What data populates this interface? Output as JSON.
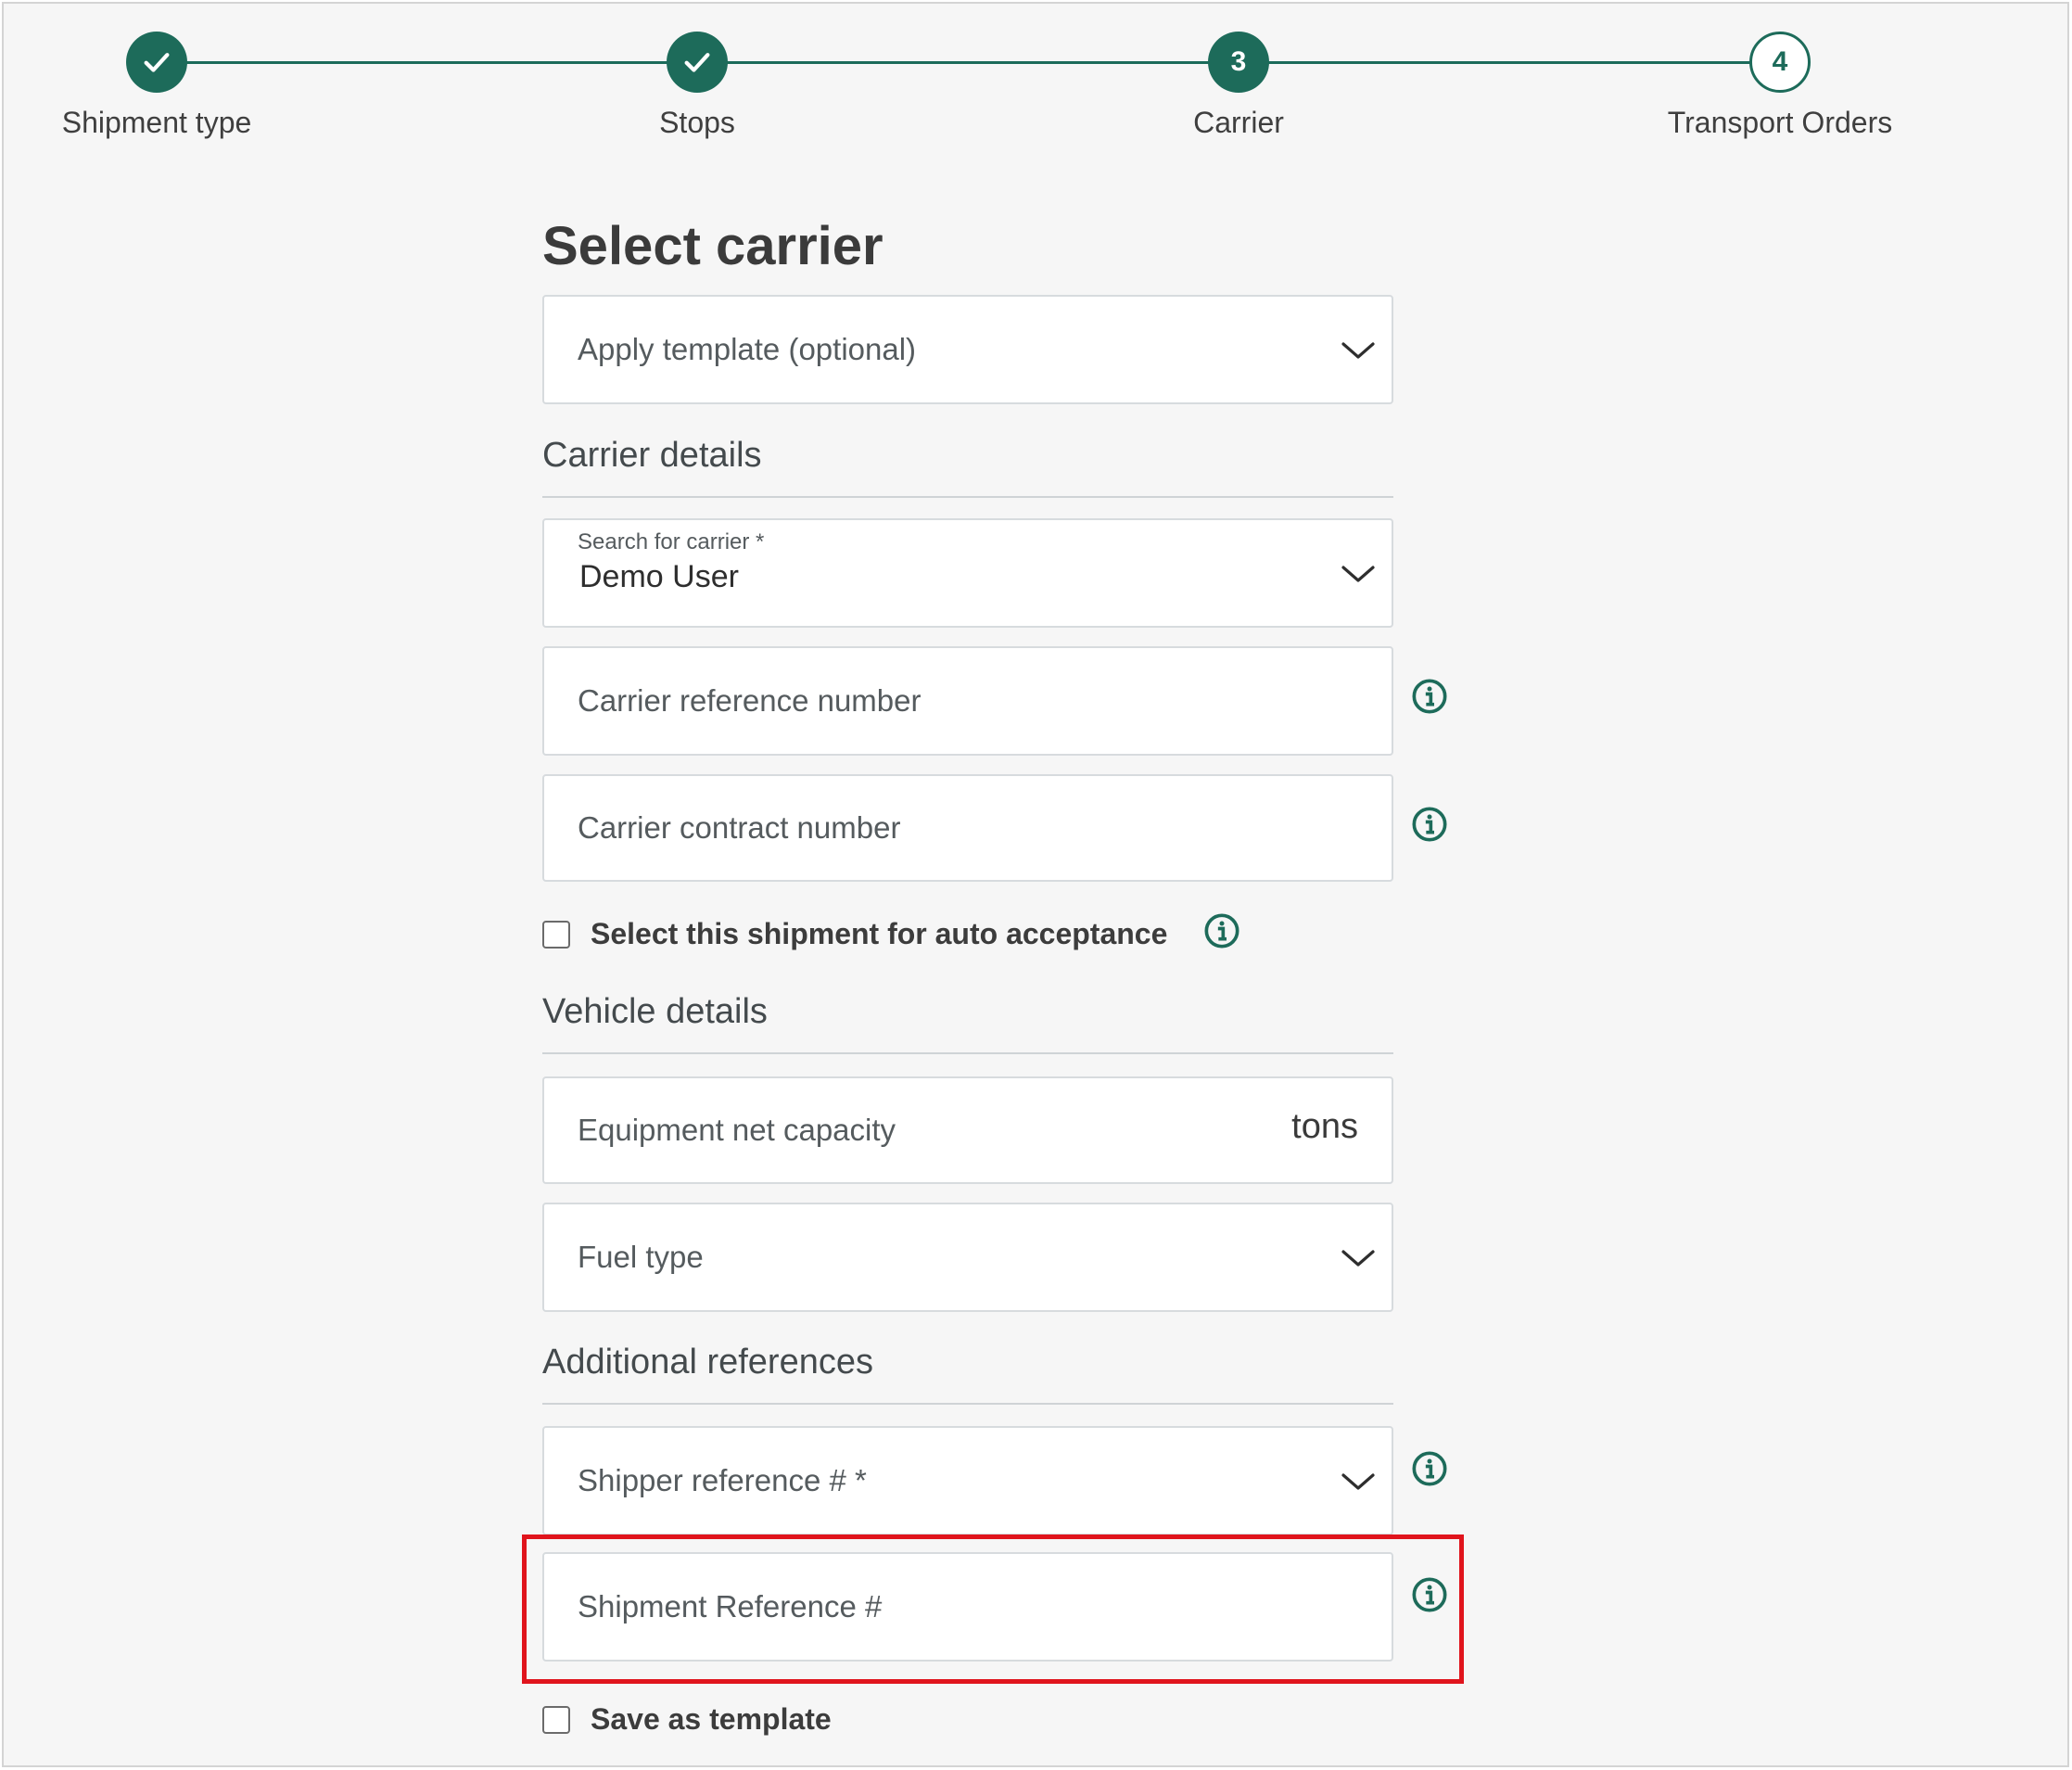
{
  "stepper": {
    "steps": [
      {
        "label": "Shipment type",
        "state": "done",
        "number": ""
      },
      {
        "label": "Stops",
        "state": "done",
        "number": ""
      },
      {
        "label": "Carrier",
        "state": "active",
        "number": "3"
      },
      {
        "label": "Transport Orders",
        "state": "pending",
        "number": "4"
      }
    ]
  },
  "page": {
    "title": "Select carrier"
  },
  "template": {
    "placeholder": "Apply template (optional)"
  },
  "carrier_details": {
    "heading": "Carrier details",
    "search_label": "Search for carrier *",
    "search_value": "Demo User",
    "reference_placeholder": "Carrier reference number",
    "contract_placeholder": "Carrier contract number",
    "auto_acceptance_label": "Select this shipment for auto acceptance",
    "auto_acceptance_checked": false
  },
  "vehicle_details": {
    "heading": "Vehicle details",
    "capacity_placeholder": "Equipment net capacity",
    "capacity_unit": "tons",
    "fuel_placeholder": "Fuel type"
  },
  "additional_references": {
    "heading": "Additional references",
    "shipper_placeholder": "Shipper reference # *",
    "shipment_placeholder": "Shipment Reference #"
  },
  "save_template": {
    "label": "Save as template",
    "checked": false
  },
  "colors": {
    "accent": "#1d6b5a",
    "highlight": "#e0141c",
    "background": "#f6f6f6"
  },
  "icons": {
    "done_step": "check-icon",
    "dropdown": "chevron-down-icon",
    "info": "info-icon"
  }
}
